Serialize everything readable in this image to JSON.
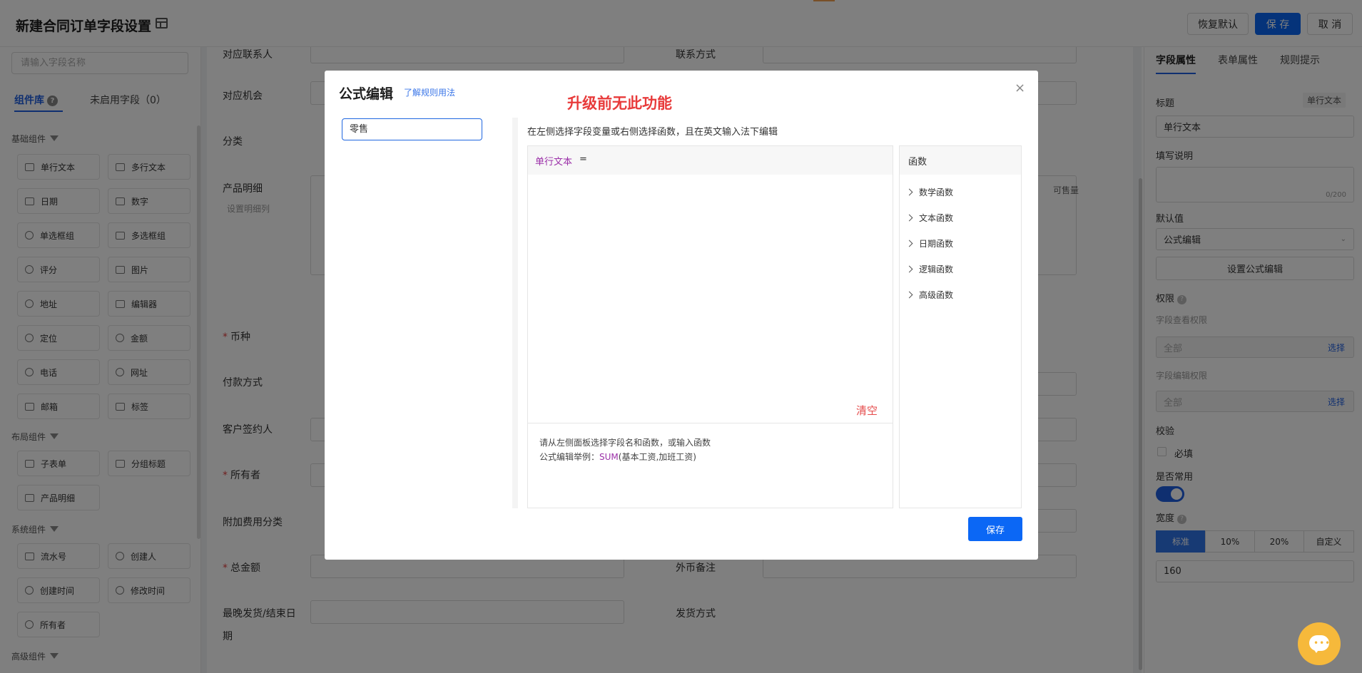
{
  "header": {
    "title": "新建合同订单字段设置",
    "reset_label": "恢复默认",
    "save_label": "保 存",
    "cancel_label": "取 消"
  },
  "left_panel": {
    "search_placeholder": "请输入字段名称",
    "tab_library": "组件库",
    "tab_unused": "未启用字段（0）",
    "sections": {
      "basic": "基础组件",
      "layout": "布局组件",
      "system": "系统组件",
      "advanced": "高级组件"
    },
    "basic_items": [
      "单行文本",
      "多行文本",
      "日期",
      "数字",
      "单选框组",
      "多选框组",
      "评分",
      "图片",
      "地址",
      "编辑器",
      "定位",
      "金额",
      "电话",
      "网址",
      "邮箱",
      "标签"
    ],
    "layout_items": [
      "子表单",
      "分组标题",
      "产品明细"
    ],
    "system_items": [
      "流水号",
      "创建人",
      "创建时间",
      "修改时间",
      "所有者"
    ]
  },
  "form": {
    "labels": {
      "contact": "对应联系人",
      "contact_way": "联系方式",
      "opportunity": "对应机会",
      "category": "分类",
      "product_detail": "产品明细",
      "detail_setting": "设置明细列",
      "available": "可售量",
      "currency": "币种",
      "payment": "付款方式",
      "signer": "客户签约人",
      "owner": "所有者",
      "fee_category": "附加费用分类",
      "total": "总金额",
      "fx_note": "外币备注",
      "last_delivery": "最晚发货/结束日",
      "last_delivery_tail": "期",
      "delivery_way": "发货方式"
    }
  },
  "right_panel": {
    "tabs": [
      "字段属性",
      "表单属性",
      "规则提示"
    ],
    "title_label": "标题",
    "type_tag": "单行文本",
    "title_value": "单行文本",
    "desc_label": "填写说明",
    "desc_counter": "0/200",
    "default_label": "默认值",
    "default_value": "公式编辑",
    "set_formula_button": "设置公式编辑",
    "permission_label": "权限",
    "view_permission_label": "字段查看权限",
    "view_permission_value": "全部",
    "edit_permission_label": "字段编辑权限",
    "edit_permission_value": "全部",
    "select_label": "选择",
    "validate_label": "校验",
    "required_label": "必填",
    "common_label": "是否常用",
    "width_label": "宽度",
    "width_options": [
      "标准",
      "10%",
      "20%",
      "自定义"
    ],
    "width_value": "160"
  },
  "modal": {
    "title": "公式编辑",
    "help_link": "了解规则用法",
    "watermark": "升级前无此功能",
    "close": "×",
    "search_value": "零售",
    "hint": "在左侧选择字段变量或右侧选择函数，且在英文输入法下编辑",
    "editor_var": "单行文本",
    "editor_eq": "=",
    "clear_label": "清空",
    "footer_line1": "请从左侧面板选择字段名和函数，或输入函数",
    "footer_example_prefix": "公式编辑举例：",
    "footer_example_fn": "SUM",
    "footer_example_args": "(基本工资,加班工资)",
    "functions_head": "函数",
    "function_groups": [
      "数学函数",
      "文本函数",
      "日期函数",
      "逻辑函数",
      "高级函数"
    ],
    "save_label": "保存"
  }
}
